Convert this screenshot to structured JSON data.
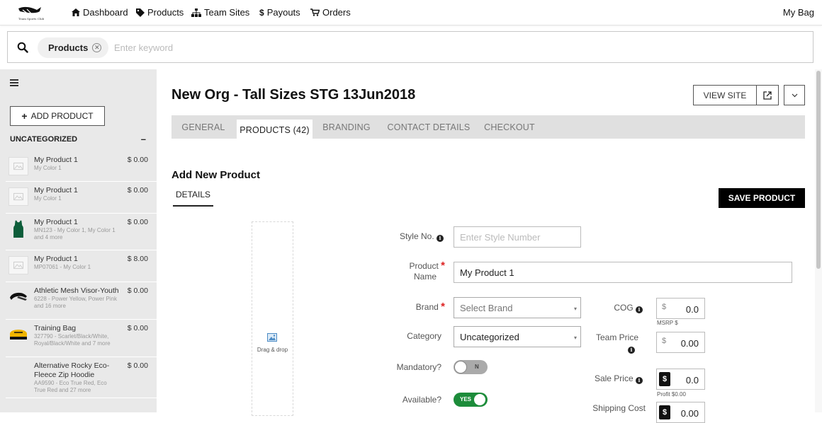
{
  "nav": {
    "items": [
      {
        "icon": "home-icon",
        "label": "Dashboard"
      },
      {
        "icon": "tag-icon",
        "label": "Products"
      },
      {
        "icon": "sitemap-icon",
        "label": "Team Sites"
      },
      {
        "icon": "dollar-icon",
        "label": "Payouts"
      },
      {
        "icon": "cart-icon",
        "label": "Orders"
      }
    ],
    "my_bag": "My Bag"
  },
  "search": {
    "chip": "Products",
    "placeholder": "Enter keyword",
    "value": ""
  },
  "sidebar": {
    "add_product": "ADD PRODUCT",
    "category": "UNCATEGORIZED",
    "collapse": "–",
    "products": [
      {
        "name": "My Product 1",
        "price": "$ 0.00",
        "desc": "My Color 1",
        "thumb": "placeholder"
      },
      {
        "name": "My Product 1",
        "price": "$ 0.00",
        "desc": "My Color 1",
        "thumb": "placeholder"
      },
      {
        "name": "My Product 1",
        "price": "$ 0.00",
        "desc": "MN123 - My Color 1, My Color 1 and 4 more",
        "thumb": "tank"
      },
      {
        "name": "My Product 1",
        "price": "$ 8.00",
        "desc": "MP07061 - My Color 1",
        "thumb": "placeholder"
      },
      {
        "name": "Athletic Mesh Visor-Youth",
        "price": "$ 0.00",
        "desc": "6228 - Power Yellow, Power Pink and 16 more",
        "thumb": "visor"
      },
      {
        "name": "Training Bag",
        "price": "$ 0.00",
        "desc": "327790 - Scarlet/Black/White, Royal/Black/White and 7 more",
        "thumb": "bag"
      },
      {
        "name": "Alternative Rocky Eco-Fleece Zip Hoodie",
        "price": "$ 0.00",
        "desc": "AA9590 - Eco True Red, Eco True Red and 27 more",
        "thumb": "none"
      }
    ]
  },
  "main": {
    "title": "New Org - Tall Sizes STG 13Jun2018",
    "view_site": "VIEW SITE",
    "tabs": [
      "GENERAL",
      "PRODUCTS (42)",
      "BRANDING",
      "CONTACT DETAILS",
      "CHECKOUT"
    ],
    "active_tab": 1,
    "section_title": "Add New Product",
    "subtab": "DETAILS",
    "save": "SAVE PRODUCT",
    "dropzone": "Drag & drop",
    "form": {
      "style_label": "Style No.",
      "style_placeholder": "Enter Style Number",
      "name_label_1": "Product",
      "name_label_2": "Name",
      "name_value": "My Product 1",
      "brand_label": "Brand",
      "brand_placeholder": "Select Brand",
      "category_label": "Category",
      "category_value": "Uncategorized",
      "mandatory_label": "Mandatory?",
      "mandatory_state": "N",
      "available_label": "Available?",
      "available_state": "YES",
      "cog_label": "COG",
      "cog_value": "0.0",
      "msrp_note": "MSRP $",
      "team_price_label": "Team Price",
      "team_price_value": "0.00",
      "sale_price_label": "Sale Price",
      "sale_price_value": "0.0",
      "profit_note": "Profit $0.00",
      "shipping_label": "Shipping Cost",
      "shipping_value": "0.00",
      "currency": "$"
    }
  },
  "colors": {
    "accent_dark": "#000000",
    "toggle_on": "#1c8c3a",
    "required": "#dd2222"
  }
}
